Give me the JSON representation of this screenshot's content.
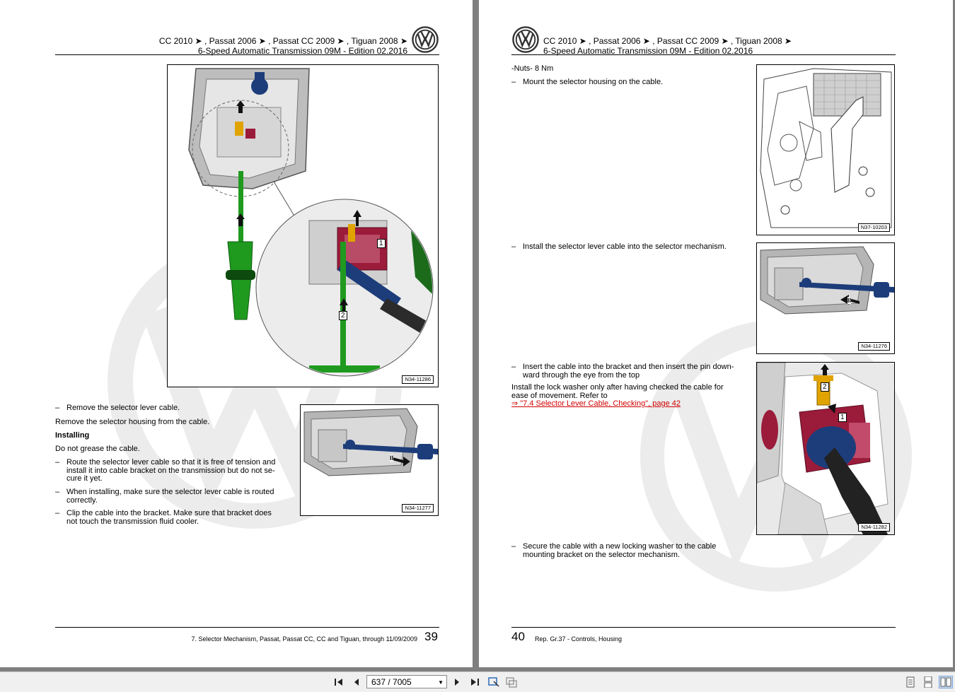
{
  "left_page": {
    "header_line1": "CC 2010 ➤ , Passat 2006 ➤ , Passat CC 2009 ➤ , Tiguan 2008 ➤",
    "header_line2": "6-Speed Automatic Transmission 09M - Edition 02.2016",
    "figure_main": {
      "label": "N34-11286",
      "callouts": [
        "1",
        "2"
      ]
    },
    "figure_small": {
      "label": "N34-11277",
      "callouts": [
        "II"
      ]
    },
    "steps": {
      "remove_cable": "Remove the selector lever cable.",
      "remove_housing": "Remove the selector housing from the cable.",
      "installing_heading": "Installing",
      "no_grease": "Do not grease the cable.",
      "route_cable": [
        "Route the selector lever cable so that it is free of tension and",
        "install it into cable bracket on the transmission but do not se-",
        "cure it yet."
      ],
      "when_installing": [
        "When installing, make sure the selector lever cable is routed",
        "correctly."
      ],
      "clip_cable": [
        "Clip the cable into the bracket. Make sure that bracket does",
        "not touch the transmission fluid cooler."
      ]
    },
    "footer_text": "7. Selector Mechanism, Passat, Passat CC, CC and Tiguan, through 11/09/2009",
    "page_number": "39"
  },
  "right_page": {
    "header_line1": "CC 2010 ➤ , Passat 2006 ➤ , Passat CC 2009 ➤ , Tiguan 2008 ➤",
    "header_line2": "6-Speed Automatic Transmission 09M - Edition 02.2016",
    "nuts": "-Nuts- 8 Nm",
    "steps": {
      "mount_housing": "Mount the selector housing on the cable.",
      "install_cable": "Install the selector lever cable into the selector mechanism.",
      "insert_cable": [
        "Insert the cable into the bracket and then insert the pin down-",
        "ward through the eye from the top"
      ],
      "lock_washer": [
        "Install the lock washer only after having checked the cable for",
        "ease of movement. Refer to"
      ],
      "link": "⇒ \"7.4 Selector Lever Cable, Checking\", page 42",
      "secure_cable": [
        "Secure the cable with a new locking washer to the cable",
        "mounting bracket on the selector mechanism."
      ]
    },
    "figure_top": {
      "label": "N37-10203"
    },
    "figure_mid": {
      "label": "N34-11276",
      "callouts": [
        "II"
      ]
    },
    "figure_bottom": {
      "label": "N34-11282",
      "callouts": [
        "1",
        "2"
      ]
    },
    "footer_text": "Rep. Gr.37 - Controls, Housing",
    "page_number": "40"
  },
  "toolbar": {
    "page_indicator": "637 / 7005",
    "icons": [
      "first-page-icon",
      "prev-page-icon",
      "next-page-icon",
      "last-page-icon",
      "select-text-icon",
      "snapshot-icon",
      "single-page-icon",
      "continuous-page-icon",
      "two-page-icon"
    ]
  },
  "colors": {
    "link": "#d00000",
    "green": "#1f9a1f",
    "crimson": "#9b1b3a",
    "blue": "#1c3d7a",
    "gold": "#e0a300"
  }
}
